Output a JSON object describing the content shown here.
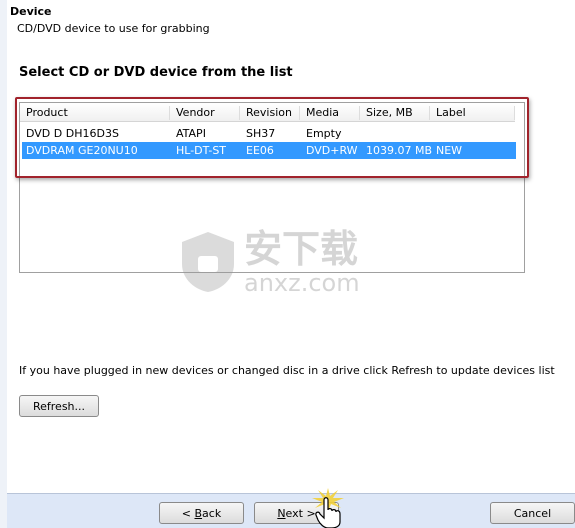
{
  "header": {
    "title": "Device",
    "subtitle": "CD/DVD device to use for grabbing"
  },
  "section_heading": "Select CD or DVD device from the list",
  "table": {
    "columns": [
      "Product",
      "Vendor",
      "Revision",
      "Media",
      "Size, MB",
      "Label"
    ],
    "rows": [
      {
        "cells": [
          "DVD D  DH16D3S",
          "ATAPI",
          "SH37",
          "Empty",
          "",
          ""
        ],
        "selected": false
      },
      {
        "cells": [
          "DVDRAM GE20NU10",
          "HL-DT-ST",
          "EE06",
          "DVD+RW",
          "1039.07 MB",
          "NEW"
        ],
        "selected": true
      }
    ]
  },
  "info_text": "If you have plugged in new devices or changed disc in a drive click Refresh to update devices list",
  "refresh_label": "Refresh...",
  "footer": {
    "back_prefix": "< ",
    "back_key": "B",
    "back_rest": "ack",
    "next_key": "N",
    "next_rest": "ext >",
    "cancel": "Cancel"
  },
  "watermark": {
    "text_cn": "安下载",
    "text_en": "anxz.com"
  },
  "colors": {
    "selection": "#3399ff",
    "highlight_box": "#a1232c",
    "footer_bg": "#dde7f7"
  }
}
